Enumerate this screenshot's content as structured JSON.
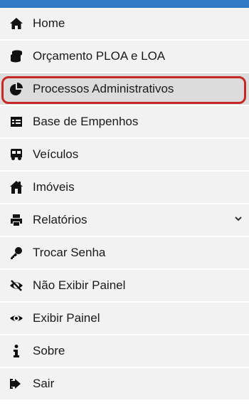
{
  "menu": {
    "items": [
      {
        "label": "Home",
        "icon": "home-icon"
      },
      {
        "label": "Orçamento PLOA e LOA",
        "icon": "coins-icon"
      },
      {
        "label": "Processos Administrativos",
        "icon": "pie-chart-icon"
      },
      {
        "label": "Base de Empenhos",
        "icon": "table-icon"
      },
      {
        "label": "Veículos",
        "icon": "bus-icon"
      },
      {
        "label": "Imóveis",
        "icon": "house-building-icon"
      },
      {
        "label": "Relatórios",
        "icon": "printer-icon"
      },
      {
        "label": "Trocar Senha",
        "icon": "key-icon"
      },
      {
        "label": "Não Exibir Painel",
        "icon": "eye-slash-icon"
      },
      {
        "label": "Exibir Painel",
        "icon": "eye-icon"
      },
      {
        "label": "Sobre",
        "icon": "info-icon"
      },
      {
        "label": "Sair",
        "icon": "sign-out-icon"
      }
    ]
  },
  "colors": {
    "topbar": "#2f7ac2",
    "item_bg": "#f2f2f2",
    "active_bg": "#dcdcdc",
    "highlight_border": "#c62828"
  }
}
